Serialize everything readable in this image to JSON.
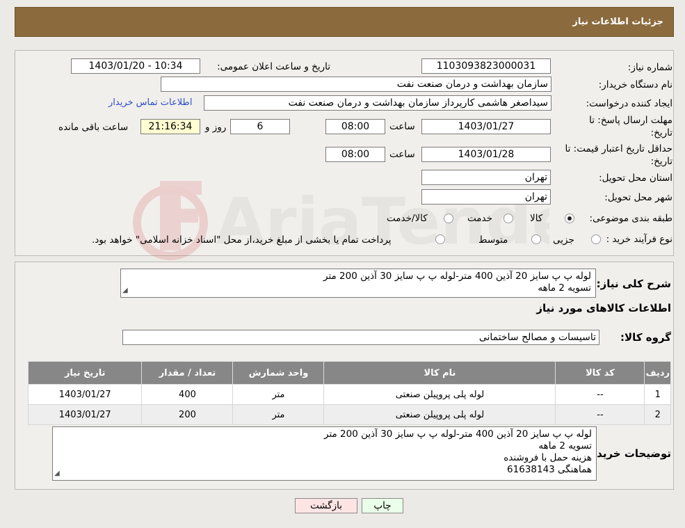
{
  "header": {
    "title": "جزئیات اطلاعات نیاز"
  },
  "form": {
    "need_number_label": "شماره نیاز:",
    "need_number": "1103093823000031",
    "announce_label": "تاریخ و ساعت اعلان عمومی:",
    "announce_value": "1403/01/20 - 10:34",
    "buyer_org_label": "نام دستگاه خریدار:",
    "buyer_org": "سازمان بهداشت و درمان صنعت نفت",
    "requester_label": "ایجاد کننده درخواست:",
    "requester": "سیداصغر هاشمی کارپرداز سازمان بهداشت و درمان صنعت نفت",
    "contact_link": "اطلاعات تماس خریدار",
    "deadline_label_1": "مهلت ارسال پاسخ: تا",
    "deadline_label_2": "تاریخ:",
    "deadline_date": "1403/01/27",
    "time_label": "ساعت",
    "deadline_time": "08:00",
    "days_value": "6",
    "days_label": "روز و",
    "remaining_time": "21:16:34",
    "remaining_label": "ساعت باقی مانده",
    "validity_label_1": "حداقل تاریخ اعتبار قیمت: تا",
    "validity_label_2": "تاریخ:",
    "validity_date": "1403/01/28",
    "validity_time": "08:00",
    "province_label": "استان محل تحویل:",
    "province": "تهران",
    "city_label": "شهر محل تحویل:",
    "city": "تهران",
    "category_label": "طبقه بندی موضوعی:",
    "category_options": [
      "کالا",
      "خدمت",
      "کالا/خدمت"
    ],
    "process_label": "نوع فرآیند خرید :",
    "process_options": [
      "جزیی",
      "متوسط"
    ],
    "process_note": "پرداخت تمام یا بخشی از مبلغ خرید،از محل \"اسناد خزانه اسلامی\" خواهد بود."
  },
  "details": {
    "summary_label": "شرح کلی نیاز:",
    "summary_lines": [
      "لوله پ پ سایز 20 آذین 400 متر-لوله پ پ سایز 30 آذین 200 متر",
      "تسویه 2 ماهه"
    ],
    "goods_title": "اطلاعات کالاهای مورد نیاز",
    "group_label": "گروه کالا:",
    "group_value": "تاسیسات و مصالح ساختمانی",
    "table": {
      "headers": [
        "ردیف",
        "کد کالا",
        "نام کالا",
        "واحد شمارش",
        "تعداد / مقدار",
        "تاریخ نیاز"
      ],
      "rows": [
        [
          "1",
          "--",
          "لوله پلی پروپیلن صنعتی",
          "متر",
          "400",
          "1403/01/27"
        ],
        [
          "2",
          "--",
          "لوله پلی پروپیلن صنعتی",
          "متر",
          "200",
          "1403/01/27"
        ]
      ]
    },
    "buyer_notes_label": "توضیحات خریدار:",
    "buyer_notes_lines": [
      "لوله پ پ سایز 20 آذین 400 متر-لوله پ پ سایز 30 آذین 200 متر",
      "تسویه 2 ماهه",
      "هزینه حمل با فروشنده",
      "هماهنگی 61638143"
    ]
  },
  "buttons": {
    "print": "چاپ",
    "back": "بازگشت"
  },
  "watermark": {
    "text": "AriaTender.neT"
  },
  "colors": {
    "header_bg": "#8b6b3d",
    "link": "#2c4ec7",
    "table_header": "#878787",
    "remaining_bg": "#ffffd1",
    "back_btn": "#ffe4e4",
    "print_btn": "#e9ffe9"
  }
}
